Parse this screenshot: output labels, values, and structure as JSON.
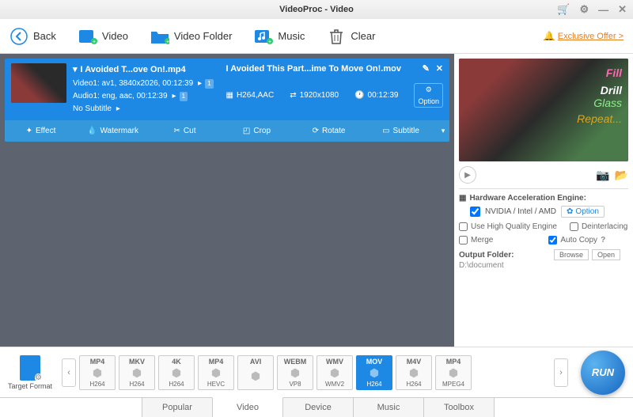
{
  "titlebar": {
    "title": "VideoProc - Video"
  },
  "toolbar": {
    "back": "Back",
    "video": "Video",
    "folder": "Video Folder",
    "music": "Music",
    "clear": "Clear",
    "exclusive": "Exclusive Offer >"
  },
  "video_item": {
    "source_title": "I Avoided T...ove On!.mp4",
    "video_stream": "Video1: av1, 3840x2026, 00:12:39",
    "audio_stream": "Audio1: eng, aac, 00:12:39",
    "subtitle": "No Subtitle",
    "output_title": "I Avoided This Part...ime To Move On!.mov",
    "codec": "H264,AAC",
    "resolution": "1920x1080",
    "duration": "00:12:39",
    "codec_option": "Option",
    "badge1": "1",
    "badge2": "1"
  },
  "edit": {
    "effect": "Effect",
    "watermark": "Watermark",
    "cut": "Cut",
    "crop": "Crop",
    "rotate": "Rotate",
    "subtitle": "Subtitle"
  },
  "preview": {
    "t1": "Fill",
    "t2": "Drill",
    "t3": "Glass",
    "t4": "Repeat..."
  },
  "hw": {
    "title": "Hardware Acceleration Engine:",
    "vendor": "NVIDIA / Intel / AMD",
    "option": "Option",
    "hq": "Use High Quality Engine",
    "deint": "Deinterlacing",
    "merge": "Merge",
    "autocopy": "Auto Copy",
    "help": "?"
  },
  "output": {
    "label": "Output Folder:",
    "path": "D:\\document",
    "browse": "Browse",
    "open": "Open"
  },
  "target_format": {
    "label": "Target Format"
  },
  "formats": [
    {
      "top": "MP4",
      "bottom": "H264"
    },
    {
      "top": "MKV",
      "bottom": "H264"
    },
    {
      "top": "4K",
      "bottom": "H264"
    },
    {
      "top": "MP4",
      "bottom": "HEVC"
    },
    {
      "top": "AVI",
      "bottom": ""
    },
    {
      "top": "WEBM",
      "bottom": "VP8"
    },
    {
      "top": "WMV",
      "bottom": "WMV2"
    },
    {
      "top": "MOV",
      "bottom": "H264",
      "active": true
    },
    {
      "top": "M4V",
      "bottom": "H264"
    },
    {
      "top": "MP4",
      "bottom": "MPEG4"
    }
  ],
  "run": "RUN",
  "tabs": {
    "popular": "Popular",
    "video": "Video",
    "device": "Device",
    "music": "Music",
    "toolbox": "Toolbox"
  }
}
